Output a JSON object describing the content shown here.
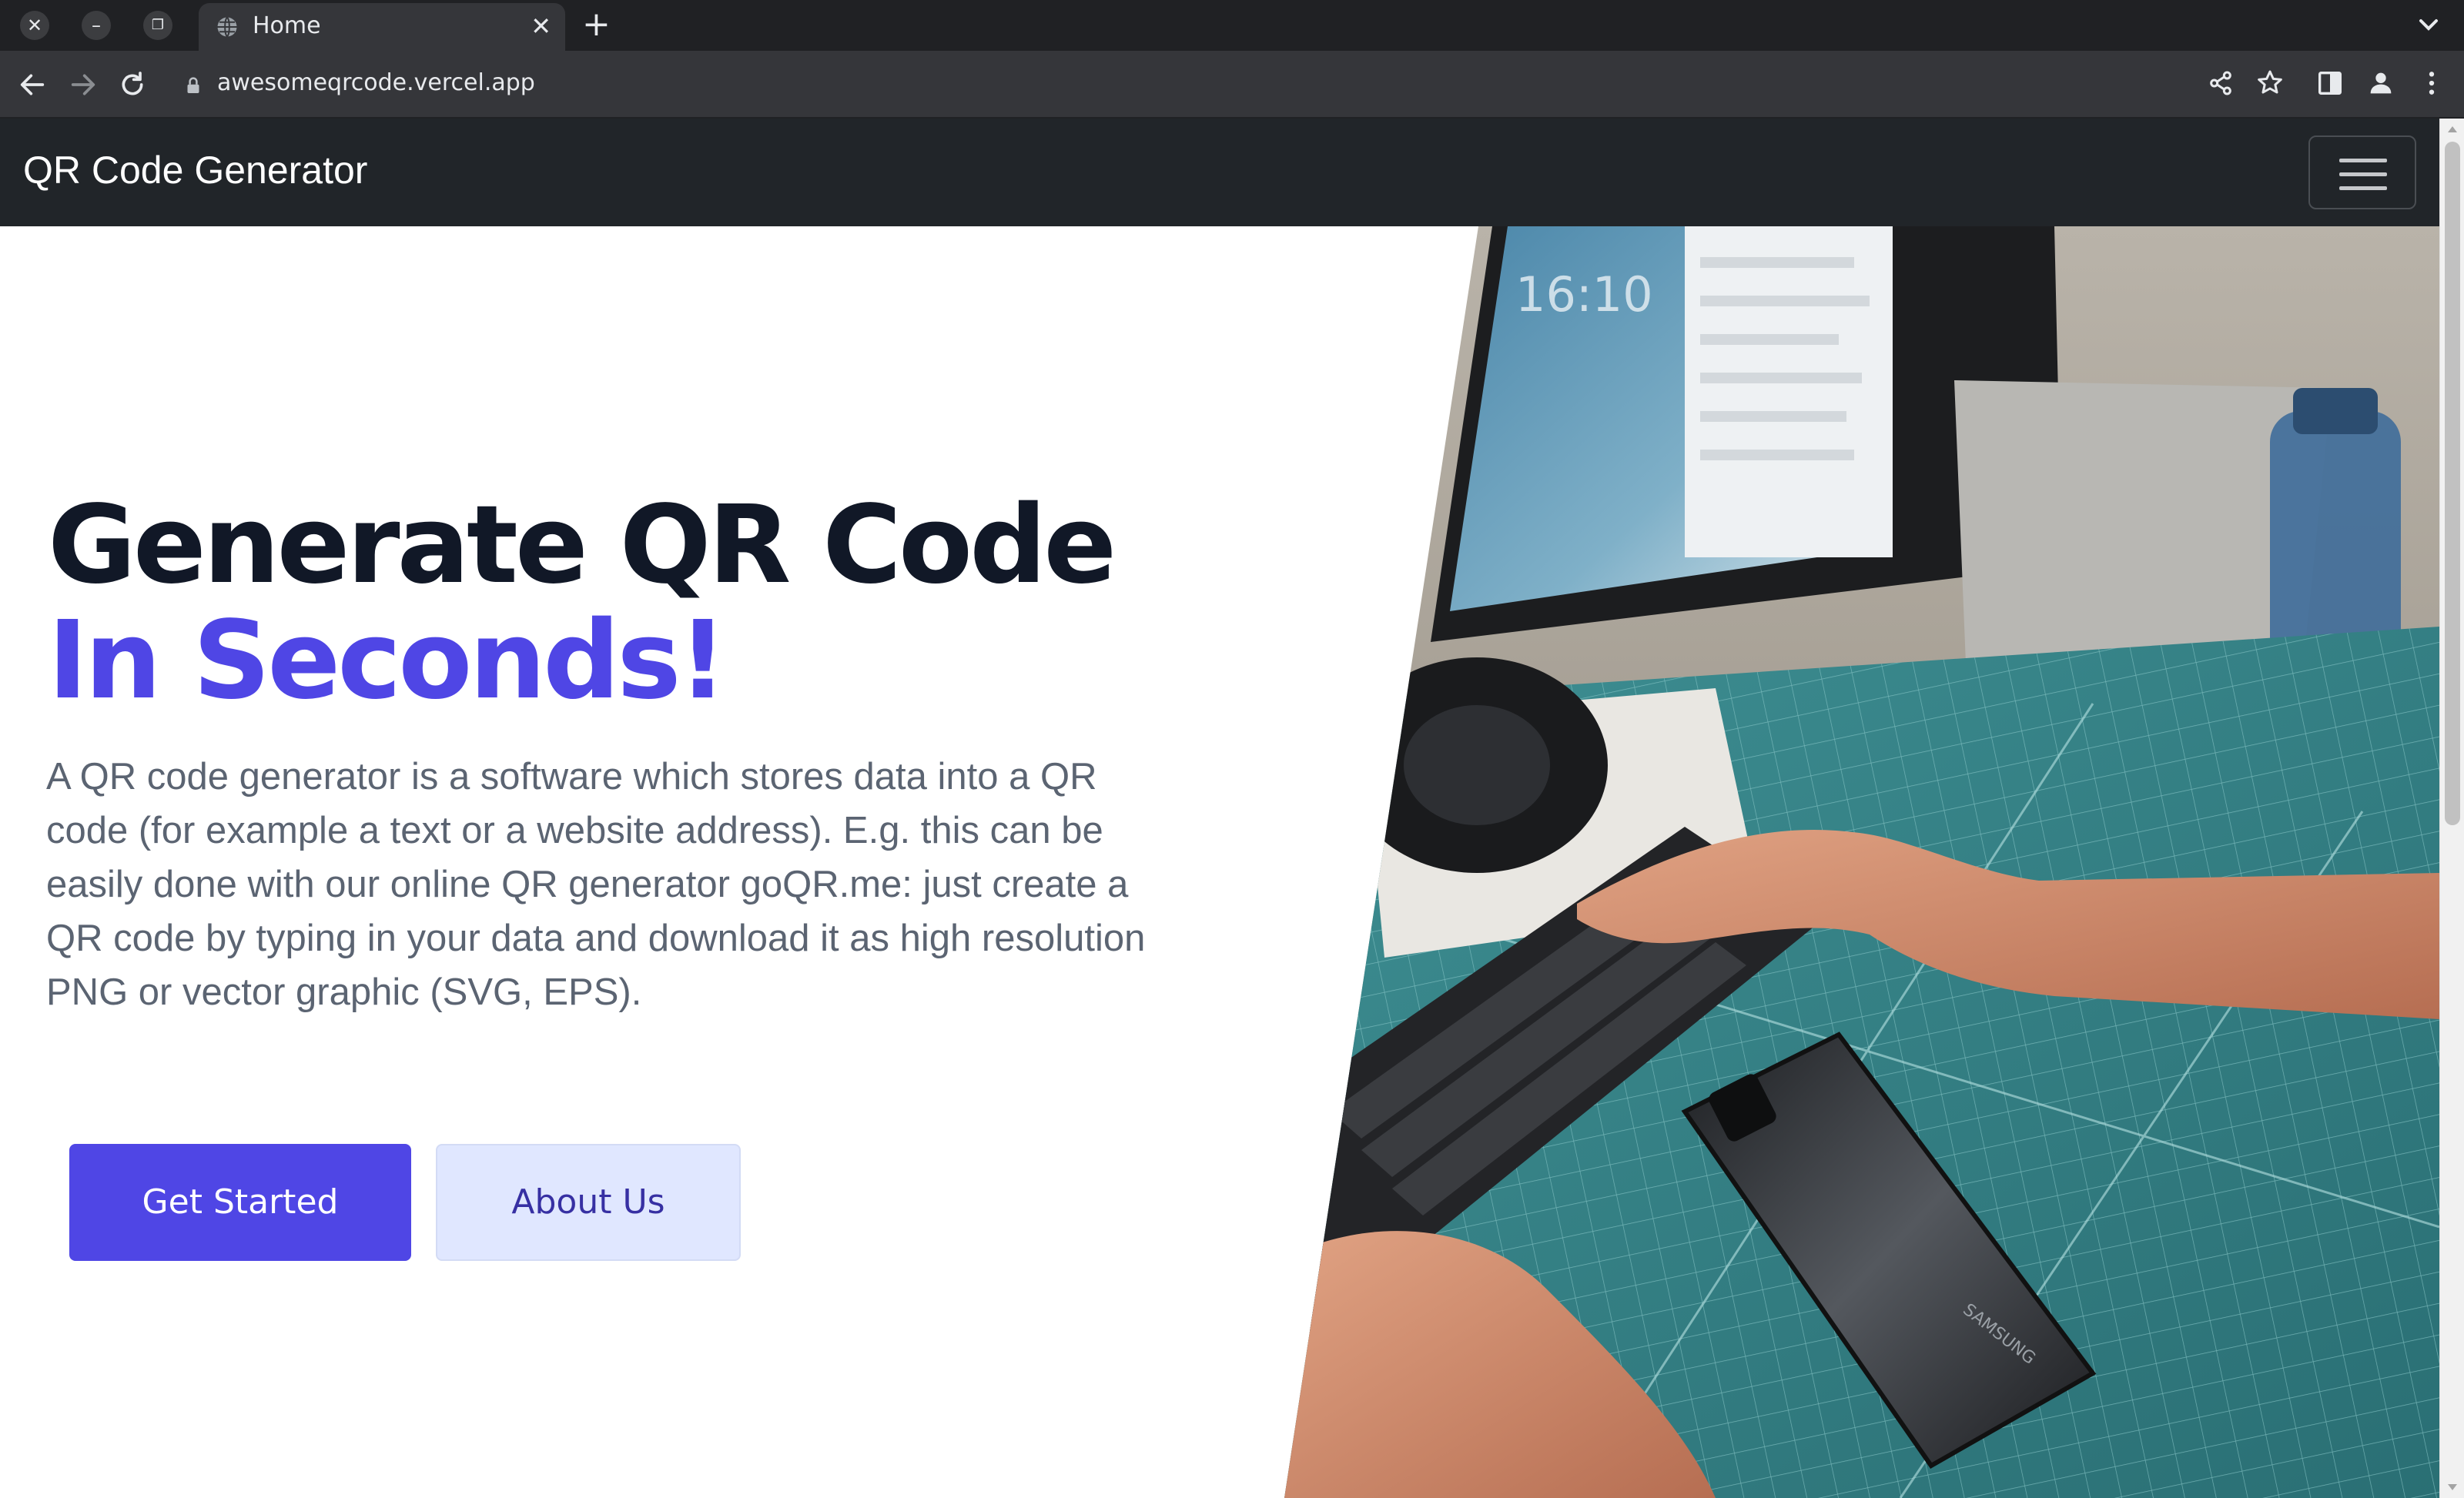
{
  "browser": {
    "tab_title": "Home",
    "url": "awesomeqrcode.vercel.app",
    "icons": [
      "close-window-icon",
      "minimize-icon",
      "restore-icon",
      "globe-icon",
      "close-tab-icon",
      "new-tab-icon",
      "tab-list-icon",
      "back-icon",
      "forward-icon",
      "reload-icon",
      "lock-icon",
      "share-icon",
      "bookmark-star-icon",
      "side-panel-icon",
      "profile-icon",
      "more-menu-icon"
    ]
  },
  "navbar": {
    "brand": "QR Code Generator",
    "toggler_icon": "hamburger-icon"
  },
  "hero": {
    "headline_main": "Generate QR Code ",
    "headline_accent": "In Seconds!",
    "lead": "A QR code generator is a software which stores data into a QR code (for example a text or a website address). E.g. this can be easily done with our online QR generator goQR.me: just create a QR code by typing in your data and download it as high resolution PNG or vector graphic (SVG, EPS).",
    "primary_button": "Get Started",
    "secondary_button": "About Us",
    "image_text": {
      "clock": "16:10",
      "phone_brand": "SAMSUNG"
    }
  },
  "colors": {
    "accent": "#4f46e5",
    "heading": "#111827",
    "lead": "#5b6472",
    "navbar": "#212529",
    "secondary_button_bg": "#e0e7ff"
  }
}
